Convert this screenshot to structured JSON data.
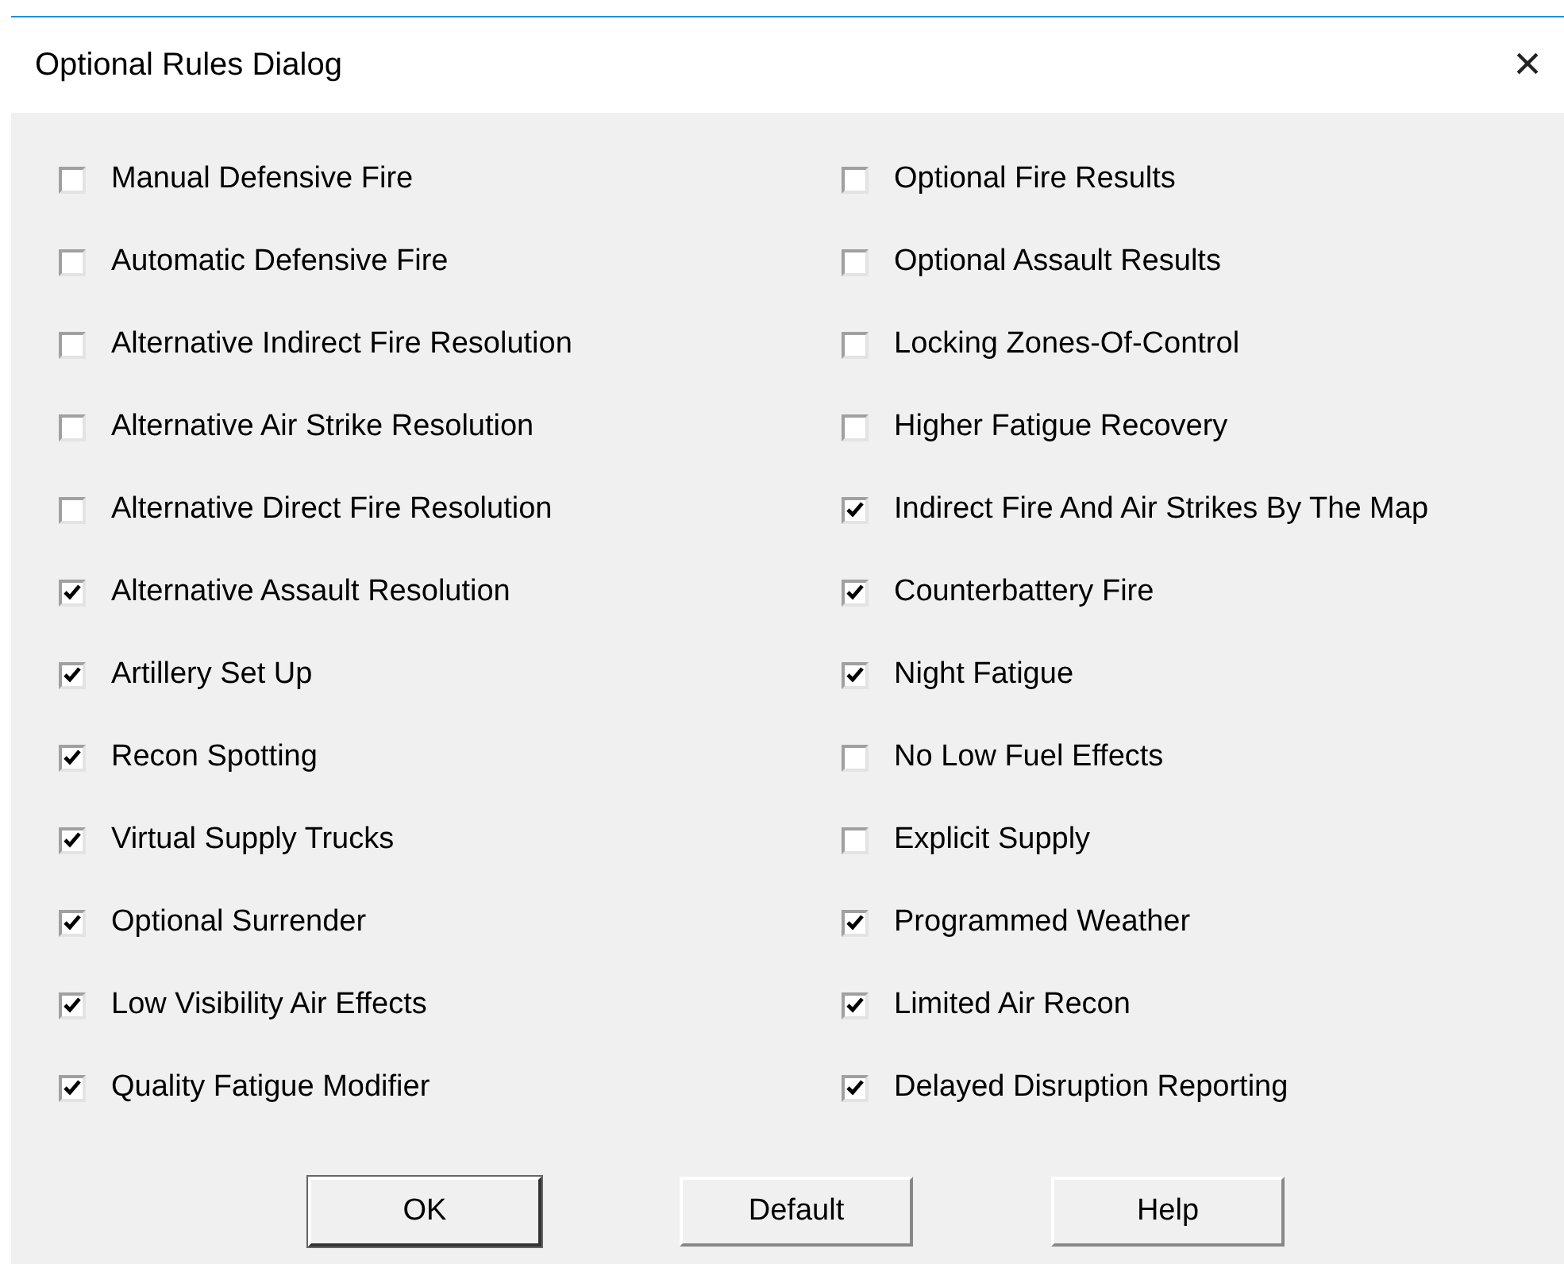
{
  "window": {
    "title": "Optional Rules Dialog",
    "close": "×"
  },
  "columns": [
    [
      {
        "label": "Manual Defensive Fire",
        "checked": false
      },
      {
        "label": "Automatic Defensive Fire",
        "checked": false
      },
      {
        "label": "Alternative Indirect Fire Resolution",
        "checked": false
      },
      {
        "label": "Alternative Air Strike Resolution",
        "checked": false
      },
      {
        "label": "Alternative Direct Fire Resolution",
        "checked": false
      },
      {
        "label": "Alternative Assault Resolution",
        "checked": true
      },
      {
        "label": "Artillery Set Up",
        "checked": true
      },
      {
        "label": "Recon Spotting",
        "checked": true
      },
      {
        "label": "Virtual Supply Trucks",
        "checked": true
      },
      {
        "label": "Optional Surrender",
        "checked": true
      },
      {
        "label": "Low Visibility Air Effects",
        "checked": true
      },
      {
        "label": "Quality Fatigue Modifier",
        "checked": true
      }
    ],
    [
      {
        "label": "Optional Fire Results",
        "checked": false
      },
      {
        "label": "Optional Assault Results",
        "checked": false
      },
      {
        "label": "Locking Zones-Of-Control",
        "checked": false
      },
      {
        "label": "Higher Fatigue Recovery",
        "checked": false
      },
      {
        "label": "Indirect Fire And Air Strikes By The Map",
        "checked": true
      },
      {
        "label": "Counterbattery Fire",
        "checked": true
      },
      {
        "label": "Night Fatigue",
        "checked": true
      },
      {
        "label": "No Low Fuel Effects",
        "checked": false
      },
      {
        "label": "Explicit Supply",
        "checked": false
      },
      {
        "label": "Programmed Weather",
        "checked": true
      },
      {
        "label": "Limited Air Recon",
        "checked": true
      },
      {
        "label": "Delayed Disruption Reporting",
        "checked": true
      }
    ]
  ],
  "buttons": [
    {
      "label": "OK",
      "default": true
    },
    {
      "label": "Default",
      "default": false
    },
    {
      "label": "Help",
      "default": false
    }
  ]
}
